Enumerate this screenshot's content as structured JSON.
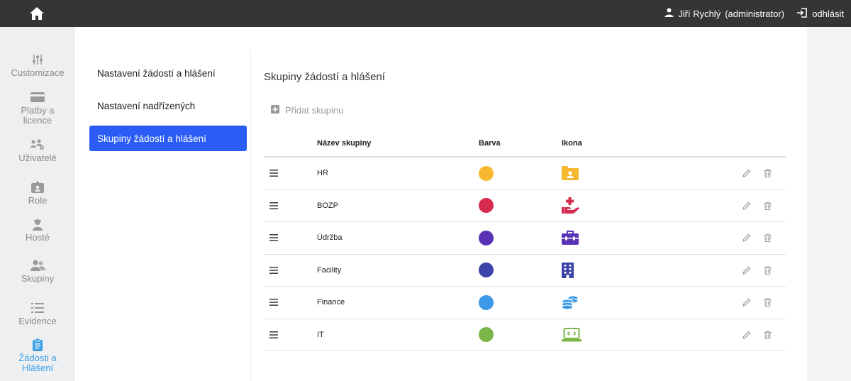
{
  "user": {
    "name": "Jiří Rychlý",
    "role": "(administrator)"
  },
  "logout_label": "odhlásit",
  "sidebar": {
    "items": [
      {
        "label": "Customizace",
        "icon": "sliders-icon"
      },
      {
        "label": "Platby a licence",
        "icon": "credit-card-icon"
      },
      {
        "label": "Uživatelé",
        "icon": "users-cog-icon"
      },
      {
        "label": "Role",
        "icon": "id-badge-icon"
      },
      {
        "label": "Hosté",
        "icon": "guest-icon"
      },
      {
        "label": "Skupiny",
        "icon": "user-group-icon"
      },
      {
        "label": "Evidence",
        "icon": "list-icon"
      },
      {
        "label": "Žádosti a Hlášení",
        "icon": "clipboard-icon"
      }
    ]
  },
  "subnav": {
    "items": [
      {
        "label": "Nastavení žádostí a hlášení"
      },
      {
        "label": "Nastavení nadřízených"
      },
      {
        "label": "Skupiny žádostí a hlášení"
      }
    ]
  },
  "page": {
    "title": "Skupiny žádostí a hlášení",
    "add_label": "Přidat skupinu"
  },
  "table": {
    "headers": {
      "name": "Název skupiny",
      "color": "Barva",
      "icon": "Ikona"
    },
    "rows": [
      {
        "name": "HR",
        "color": "#f5b82e",
        "icon": "folder-user-icon"
      },
      {
        "name": "BOZP",
        "color": "#d6294d",
        "icon": "hand-medical-icon"
      },
      {
        "name": "Údržba",
        "color": "#5a33b5",
        "icon": "toolbox-icon"
      },
      {
        "name": "Facility",
        "color": "#3a44a8",
        "icon": "building-icon"
      },
      {
        "name": "Finance",
        "color": "#3d9ae8",
        "icon": "coins-icon"
      },
      {
        "name": "IT",
        "color": "#7db648",
        "icon": "laptop-code-icon"
      }
    ]
  },
  "colors": {
    "accent": "#2b5cf5",
    "active_sidebar": "#3aa0e8",
    "topbar": "#353535"
  }
}
